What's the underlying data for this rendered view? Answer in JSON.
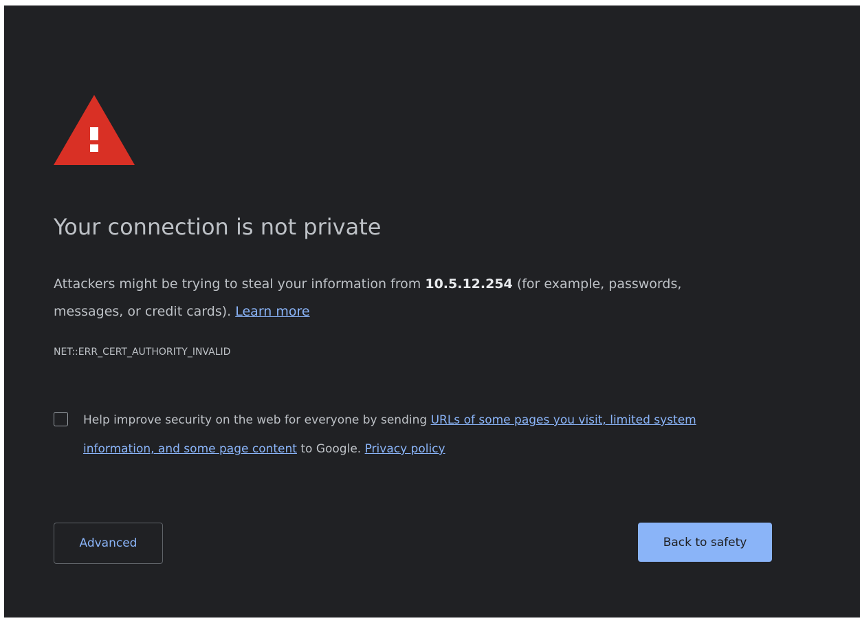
{
  "error": {
    "title": "Your connection is not private",
    "message_prefix": "Attackers might be trying to steal your information from",
    "host": "10.5.12.254",
    "message_suffix": "(for example, passwords, messages, or credit cards).",
    "learn_more_label": "Learn more",
    "error_code": "NET::ERR_CERT_AUTHORITY_INVALID"
  },
  "optin": {
    "checked": false,
    "text_prefix": "Help improve security on the web for everyone by sending",
    "link_label": "URLs of some pages you visit, limited system information, and some page content",
    "text_middle": "to Google.",
    "privacy_label": "Privacy policy"
  },
  "buttons": {
    "advanced_label": "Advanced",
    "back_label": "Back to safety"
  },
  "colors": {
    "background": "#202124",
    "icon": "#d93025",
    "text": "#bdc1c6",
    "link": "#8ab4f8",
    "primary_button": "#8ab4f8"
  },
  "icons": {
    "warning": "warning-triangle-icon"
  }
}
